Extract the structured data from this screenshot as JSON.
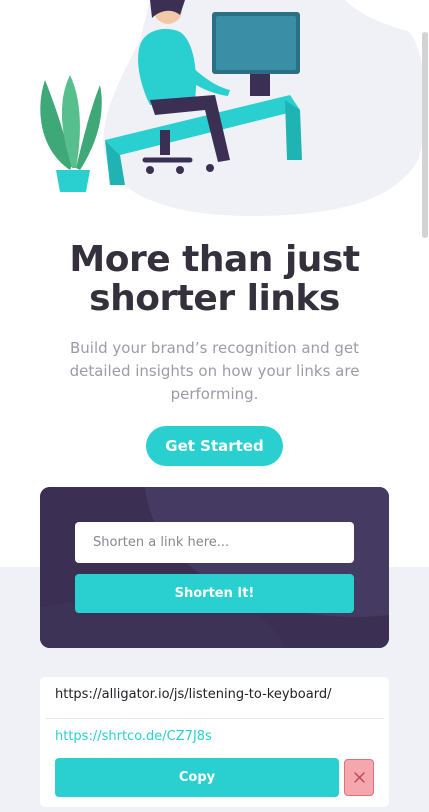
{
  "hero": {
    "illustration_icon": "person-working-at-desk-illustration"
  },
  "headline": {
    "line1": "More than just",
    "line2": "shorter links"
  },
  "subtext": "Build your brand’s recognition and get detailed insights on how your links are performing.",
  "cta": {
    "get_started_label": "Get Started"
  },
  "shorten_form": {
    "placeholder": "Shorten a link here...",
    "value": "",
    "button_label": "Shorten It!"
  },
  "results": [
    {
      "original_url": "https://alligator.io/js/listening-to-keyboard/",
      "short_url": "https://shrtco.de/CZ7J8s",
      "copy_label": "Copy",
      "delete_icon": "close-icon"
    }
  ],
  "colors": {
    "primary": "#2acfcf",
    "dark_violet": "#3b3054",
    "text_dark": "#34313d",
    "text_gray": "#9e9aa7",
    "band_gray": "#f0f1f6",
    "delete_red": "#f4a8ad"
  }
}
